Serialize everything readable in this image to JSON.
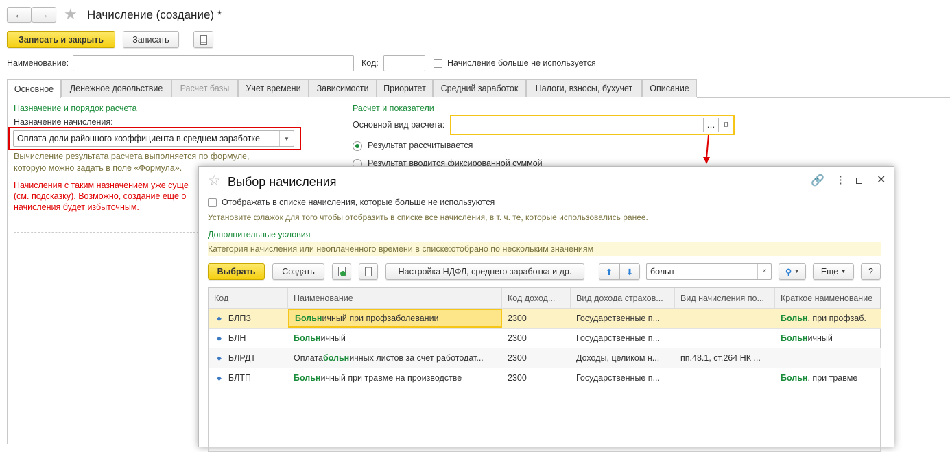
{
  "window": {
    "title": "Начисление (создание) *"
  },
  "toolbar": {
    "save_close": "Записать и закрыть",
    "save": "Записать"
  },
  "fields": {
    "name_label": "Наименование:",
    "name_value": "",
    "code_label": "Код:",
    "code_value": "",
    "not_used_label": "Начисление больше не используется",
    "not_used_checked": false
  },
  "tabs": [
    {
      "label": "Основное",
      "active": true
    },
    {
      "label": "Денежное довольствие"
    },
    {
      "label": "Расчет базы",
      "disabled": true
    },
    {
      "label": "Учет времени"
    },
    {
      "label": "Зависимости"
    },
    {
      "label": "Приоритет"
    },
    {
      "label": "Средний заработок"
    },
    {
      "label": "Налоги, взносы, бухучет"
    },
    {
      "label": "Описание"
    }
  ],
  "left": {
    "heading": "Назначение и порядок расчета",
    "purpose_label": "Назначение начисления:",
    "purpose_value": "Оплата доли районного коэффициента в среднем заработке",
    "hint1": "Вычисление результата расчета выполняется по формуле,",
    "hint2": "которую можно задать в поле «Формула».",
    "warn1": "Начисления с таким назначением уже суще",
    "warn2": "(см. подсказку). Возможно, создание еще о",
    "warn3": "начисления будет избыточным."
  },
  "right": {
    "heading": "Расчет и показатели",
    "base_label": "Основной вид расчета:",
    "base_value": "",
    "radio1": "Результат рассчитывается",
    "radio2": "Результат вводится фиксированной суммой",
    "radio_selected": 1
  },
  "dialog": {
    "title": "Выбор начисления",
    "show_unused_label": "Отображать в списке начисления, которые больше не используются",
    "show_unused_checked": false,
    "hint": "Установите флажок для того чтобы отобразить в списке все начисления, в т. ч. те, которые использовались ранее.",
    "extra_heading": "Дополнительные условия",
    "filter_text": "Категория начисления или неоплаченного времени в списке:отобрано по нескольким значениям",
    "select_btn": "Выбрать",
    "create_btn": "Создать",
    "settings_btn": "Настройка НДФЛ, среднего заработка и др.",
    "search_value": "больн",
    "more_btn": "Еще",
    "help_btn": "?",
    "columns": [
      "Код",
      "Наименование",
      "Код доход...",
      "Вид дохода страхов...",
      "Вид начисления по...",
      "Краткое наименование"
    ],
    "rows": [
      {
        "code": "БЛПЗ",
        "name_pre": "",
        "name_hl": "Больн",
        "name_post": "ичный при профзаболевании",
        "income": "2300",
        "ins": "Государственные п...",
        "kind": "",
        "short_hl": "Больн",
        "short_post": ". при профзаб.",
        "selected": true
      },
      {
        "code": "БЛН",
        "name_pre": "",
        "name_hl": "Больн",
        "name_post": "ичный",
        "income": "2300",
        "ins": "Государственные п...",
        "kind": "",
        "short_hl": "Больн",
        "short_post": "ичный"
      },
      {
        "code": "БЛРДТ",
        "name_pre": "Оплата ",
        "name_hl": "больн",
        "name_post": "ичных листов за счет работодат...",
        "income": "2300",
        "ins": "Доходы, целиком н...",
        "kind": "пп.48.1, ст.264 НК ...",
        "short_hl": "",
        "short_post": ""
      },
      {
        "code": "БЛТП",
        "name_pre": "",
        "name_hl": "Больн",
        "name_post": "ичный при травме на производстве",
        "income": "2300",
        "ins": "Государственные п...",
        "kind": "",
        "short_hl": "Больн",
        "short_post": ". при травме"
      }
    ]
  },
  "colors": {
    "accent_yellow": "#f5cf10",
    "heading_green": "#1a8c3a",
    "warning_red": "#e00000",
    "selected_row": "#fdf2c4"
  }
}
